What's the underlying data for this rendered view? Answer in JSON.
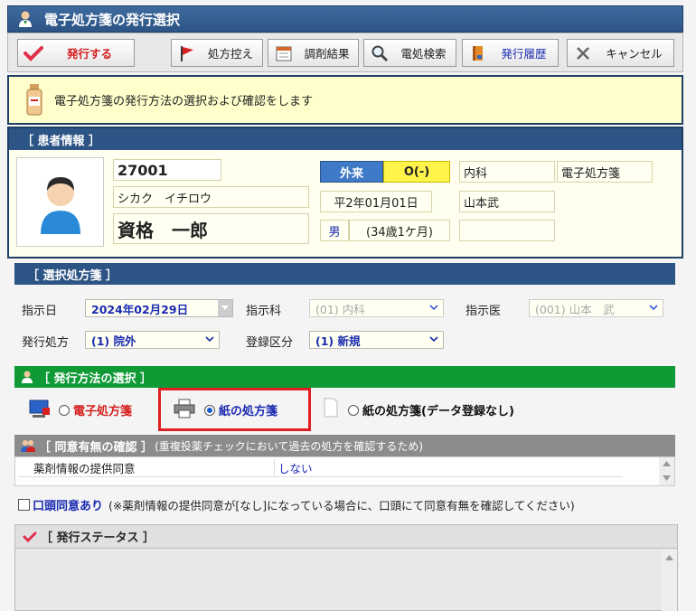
{
  "window": {
    "title": "電子処方箋の発行選択"
  },
  "toolbar": {
    "issue": "発行する",
    "copy": "処方控え",
    "dispense": "調剤結果",
    "search": "電処検索",
    "history": "発行履歴",
    "cancel": "キャンセル"
  },
  "info": {
    "message": "電子処方箋の発行方法の選択および確認をします"
  },
  "patient": {
    "section_title": "［ 患者情報 ］",
    "id": "27001",
    "kana": "シカク　イチロウ",
    "name": "資格　一郎",
    "visit_type": "外来",
    "visit_code": "O(-)",
    "department": "内科",
    "prescription_type": "電子処方箋",
    "birthdate": "平2年01月01日",
    "doctor": "山本武",
    "sex": "男",
    "age": "(34歳1ケ月)"
  },
  "selection": {
    "section_title": "［ 選択処方箋 ］",
    "date_label": "指示日",
    "date_value": "2024年02月29日",
    "dept_label": "指示科",
    "dept_value": "(01) 内科",
    "doctor_label": "指示医",
    "doctor_value": "(001) 山本　武",
    "issue_label": "発行処方",
    "issue_value": "(1) 院外",
    "reg_label": "登録区分",
    "reg_value": "(1) 新規"
  },
  "method": {
    "section_title": "［ 発行方法の選択 ］",
    "options": [
      {
        "label": "電子処方箋",
        "selected": false
      },
      {
        "label": "紙の処方箋",
        "selected": true
      },
      {
        "label": "紙の処方箋(データ登録なし)",
        "selected": false
      }
    ]
  },
  "consent": {
    "section_title": "［ 同意有無の確認 ］",
    "section_note": "(重複投薬チェックにおいて過去の処方を確認するため)",
    "item_label": "薬剤情報の提供同意",
    "item_value": "しない"
  },
  "oral": {
    "label": "口頭同意あり",
    "note": "(※薬剤情報の提供同意が[なし]になっている場合に、口頭にて同意有無を確認してください)"
  },
  "status": {
    "section_title": "［ 発行ステータス ］"
  },
  "colors": {
    "navy": "#2c5485",
    "green": "#0f9a36",
    "gray_bar": "#8c8c8c",
    "highlight": "#e02020",
    "info_bg": "#ffffcc"
  }
}
